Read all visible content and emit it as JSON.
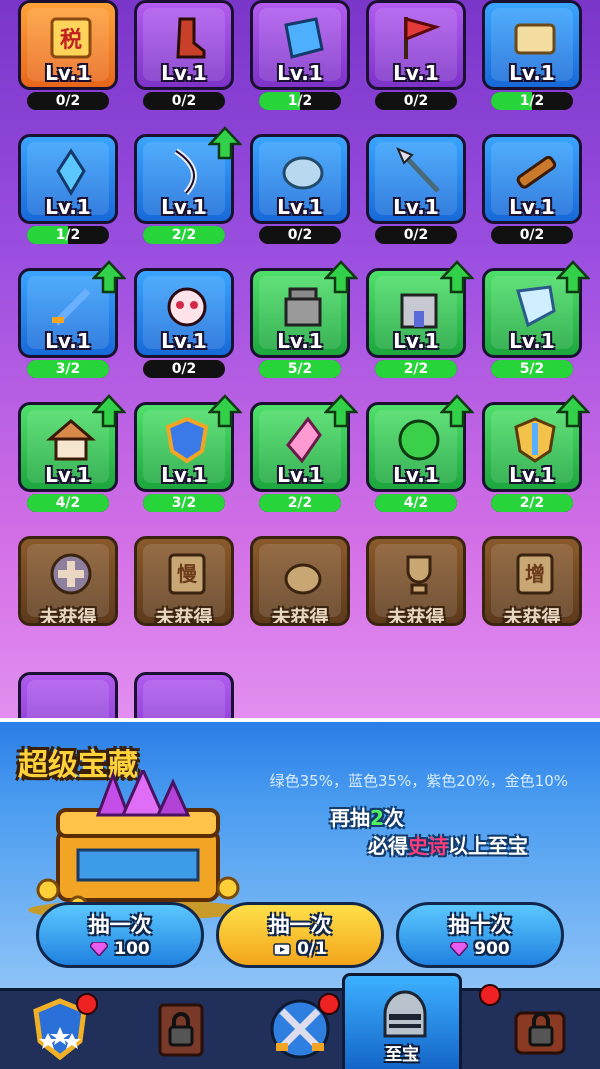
{
  "items": [
    {
      "lv": "Lv.1",
      "count": "0/2",
      "progress": 0.0,
      "color": "orange",
      "icon": "tax-scroll-icon",
      "upgrade": false
    },
    {
      "lv": "Lv.1",
      "count": "0/2",
      "progress": 0.0,
      "color": "purple",
      "icon": "boot-icon",
      "upgrade": false
    },
    {
      "lv": "Lv.1",
      "count": "1/2",
      "progress": 0.5,
      "color": "purple",
      "icon": "blue-cloth-icon",
      "upgrade": false
    },
    {
      "lv": "Lv.1",
      "count": "0/2",
      "progress": 0.0,
      "color": "purple",
      "icon": "red-flag-icon",
      "upgrade": false
    },
    {
      "lv": "Lv.1",
      "count": "1/2",
      "progress": 0.5,
      "color": "blue",
      "icon": "map-scroll-icon",
      "upgrade": false
    },
    {
      "lv": "Lv.1",
      "count": "1/2",
      "progress": 0.5,
      "color": "blue",
      "icon": "crystal-icon",
      "upgrade": false
    },
    {
      "lv": "Lv.1",
      "count": "2/2",
      "progress": 1.0,
      "color": "blue",
      "icon": "curved-blade-icon",
      "upgrade": true
    },
    {
      "lv": "Lv.1",
      "count": "0/2",
      "progress": 0.0,
      "color": "blue",
      "icon": "stone-icon",
      "upgrade": false
    },
    {
      "lv": "Lv.1",
      "count": "0/2",
      "progress": 0.0,
      "color": "blue",
      "icon": "spear-icon",
      "upgrade": false
    },
    {
      "lv": "Lv.1",
      "count": "0/2",
      "progress": 0.0,
      "color": "blue",
      "icon": "telescope-icon",
      "upgrade": false
    },
    {
      "lv": "Lv.1",
      "count": "3/2",
      "progress": 1.0,
      "color": "blue",
      "icon": "sword-icon",
      "upgrade": true
    },
    {
      "lv": "Lv.1",
      "count": "0/2",
      "progress": 0.0,
      "color": "blue",
      "icon": "skull-icon",
      "upgrade": false
    },
    {
      "lv": "Lv.1",
      "count": "5/2",
      "progress": 1.0,
      "color": "green",
      "icon": "tower-base-icon",
      "upgrade": true
    },
    {
      "lv": "Lv.1",
      "count": "2/2",
      "progress": 1.0,
      "color": "green",
      "icon": "castle-icon",
      "upgrade": true
    },
    {
      "lv": "Lv.1",
      "count": "5/2",
      "progress": 1.0,
      "color": "green",
      "icon": "ice-block-icon",
      "upgrade": true
    },
    {
      "lv": "Lv.1",
      "count": "4/2",
      "progress": 1.0,
      "color": "green",
      "icon": "house-icon",
      "upgrade": true
    },
    {
      "lv": "Lv.1",
      "count": "3/2",
      "progress": 1.0,
      "color": "green",
      "icon": "shield-icon",
      "upgrade": true
    },
    {
      "lv": "Lv.1",
      "count": "2/2",
      "progress": 1.0,
      "color": "green",
      "icon": "pink-crystal-icon",
      "upgrade": true
    },
    {
      "lv": "Lv.1",
      "count": "4/2",
      "progress": 1.0,
      "color": "green",
      "icon": "green-orb-icon",
      "upgrade": true
    },
    {
      "lv": "Lv.1",
      "count": "2/2",
      "progress": 1.0,
      "color": "green",
      "icon": "sword-shield-icon",
      "upgrade": true
    }
  ],
  "locked_items": [
    {
      "label": "未获得",
      "icon": "plus-coin-icon"
    },
    {
      "label": "未获得",
      "icon": "slow-scroll-icon",
      "glyph": "慢"
    },
    {
      "label": "未获得",
      "icon": "pouch-icon"
    },
    {
      "label": "未获得",
      "icon": "trophy-icon"
    },
    {
      "label": "未获得",
      "icon": "increase-scroll-icon",
      "glyph": "增"
    }
  ],
  "tax_glyph": "税",
  "treasure": {
    "title": "超级宝藏",
    "rates": "绿色35%，蓝色35%，紫色20%，金色10%",
    "tip_line1_pre": "再抽",
    "tip_line1_num": "2",
    "tip_line1_post": "次",
    "tip_line2_pre": "必得",
    "tip_line2_highlight": "史诗",
    "tip_line2_post": "以上至宝",
    "buttons": [
      {
        "label": "抽一次",
        "cost": "100",
        "icon": "gem-icon"
      },
      {
        "label": "抽一次",
        "cost": "0/1",
        "icon": "video-icon"
      },
      {
        "label": "抽十次",
        "cost": "900",
        "icon": "gem-icon"
      }
    ]
  },
  "nav": {
    "active_label": "至宝",
    "items": [
      "rank-shield-icon",
      "locked-book-icon",
      "crossed-swords-icon",
      "knight-helmet-icon",
      "locked-chest-icon"
    ]
  },
  "colors": {
    "green_fill": "#27d43a",
    "gem": "#e65cf0",
    "badge": "#ee2222"
  }
}
